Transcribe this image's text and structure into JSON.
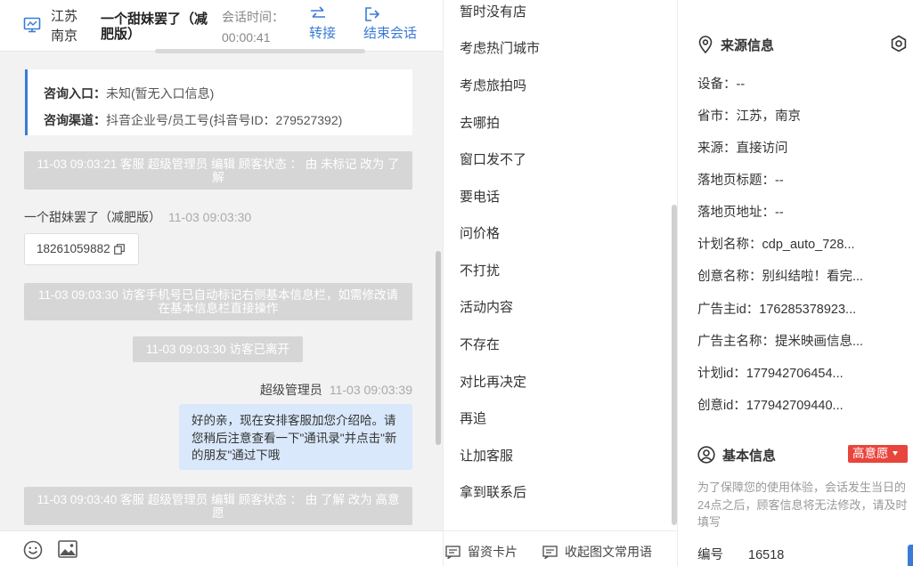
{
  "header": {
    "location_province": "江苏",
    "location_city": "南京",
    "visitor_name": "一个甜妹罢了（减肥版）",
    "session_time_label": "会话时间：",
    "session_time_value": "00:00:41",
    "transfer_label": "转接",
    "end_session_label": "结束会话"
  },
  "info_card": {
    "entry_label": "咨询入口：",
    "entry_value": "未知(暂无入口信息)",
    "channel_label": "咨询渠道：",
    "channel_value": "抖音企业号/员工号(抖音号ID：279527392)"
  },
  "messages": {
    "sys1": "11-03 09:03:21 客服 超级管理员 编辑 顾客状态 ： 由 未标记 改为 了解",
    "visitor_name": "一个甜妹罢了（减肥版）",
    "visitor_time": "11-03 09:03:30",
    "visitor_phone": "18261059882",
    "sys2": "11-03 09:03:30 访客手机号已自动标记右侧基本信息栏，如需修改请在基本信息栏直接操作",
    "sys3": "11-03 09:03:30 访客已离开",
    "agent_name": "超级管理员",
    "agent_time": "11-03 09:03:39",
    "agent_text": "好的亲，现在安排客服加您介绍哈。请您稍后注意查看一下\"通讯录\"并点击\"新的朋友\"通过下哦",
    "sys4": "11-03 09:03:40 客服 超级管理员 编辑 顾客状态 ： 由 了解 改为 高意愿"
  },
  "quick_replies": [
    "暂时没有店",
    "考虑热门城市",
    "考虑旅拍吗",
    "去哪拍",
    "窗口发不了",
    "要电话",
    "问价格",
    "不打扰",
    "活动内容",
    "不存在",
    "对比再决定",
    "再追",
    "让加客服",
    "拿到联系后"
  ],
  "mid_footer": {
    "card_label": "留资卡片",
    "collapse_label": "收起图文常用语"
  },
  "source_info": {
    "title": "来源信息",
    "device": "设备：--",
    "region": "省市：江苏，南京",
    "source": "来源：直接访问",
    "landing_title": "落地页标题：--",
    "landing_url": "落地页地址：--",
    "plan_name": "计划名称：cdp_auto_728...",
    "creative_name": "创意名称：别纠结啦！看完...",
    "advertiser_id": "广告主id：176285378923...",
    "advertiser_name": "广告主名称：提米映画信息...",
    "plan_id": "计划id：177942706454...",
    "creative_id": "创意id：177942709440..."
  },
  "basic_info": {
    "title": "基本信息",
    "intent_badge": "高意愿",
    "notice": "为了保障您的使用体验，会话发生当日的24点之后，顾客信息将无法修改，请及时填写",
    "id_label": "编号",
    "id_value": "16518"
  },
  "colors": {
    "accent": "#3a7bd5",
    "badge": "#e8453c",
    "agent_bubble": "#d9e8fb",
    "system_msg": "#d6d6d6"
  }
}
